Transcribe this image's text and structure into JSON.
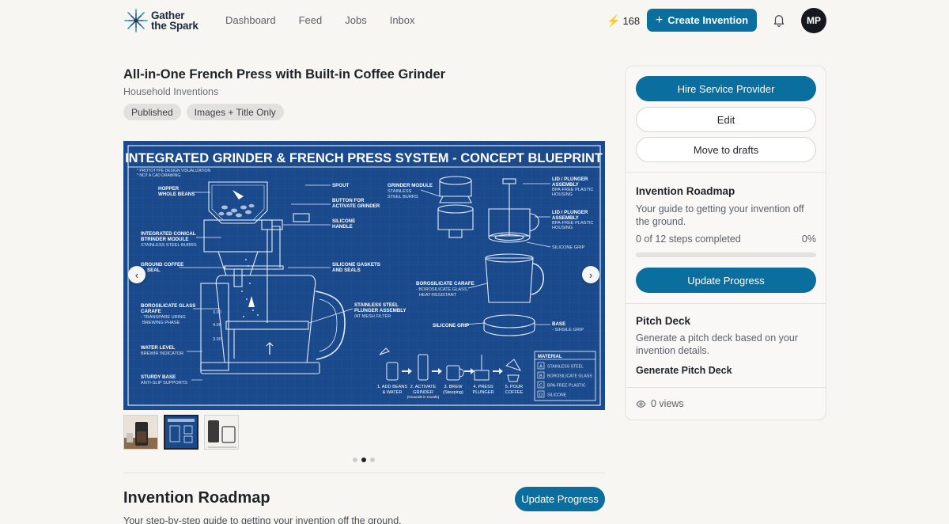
{
  "header": {
    "logo_line1": "Gather",
    "logo_line2": "the Spark",
    "nav": [
      "Dashboard",
      "Feed",
      "Jobs",
      "Inbox"
    ],
    "credits": "168",
    "create_label": "Create Invention",
    "avatar_initials": "MP"
  },
  "invention": {
    "title": "All-in-One French Press with Built-in Coffee Grinder",
    "category": "Household Inventions",
    "tags": [
      "Published",
      "Images + Title Only"
    ]
  },
  "blueprint": {
    "heading": "INTEGRATED GRINDER & FRENCH PRESS SYSTEM - CONCEPT BLUEPRINT",
    "note1": "* PROTOTYPE DESIGN VISUALIZATION",
    "note2": "* NOT A CAD DRAWING",
    "labels": {
      "hopper": "HOPPER",
      "hopper2": "WHOLE BEANS",
      "spout": "SPOUT",
      "button": "BUTTON FOR",
      "button2": "ACTIVATE GRINDER",
      "handle": "SILICONE",
      "handle2": "HANDLE",
      "grinder": "INTEGRATED CONICAL",
      "grinder2": "BTRINDER MODULE",
      "grinder3": "STAINLESS STEEL BURRS",
      "ground": "GROUND COFFEE",
      "ground2": "SEAL",
      "gaskets": "SILICONE GASKETS",
      "gaskets2": "AND SEALS",
      "carafe": "BOROSILICATE GLASS",
      "carafe2": "CARAFE",
      "carafe3": "- TRANSPARE URING",
      "carafe4": "BREWING PHASE",
      "plunger": "STAINLESS STEEL",
      "plunger2": "PLUNGER ASSEMBLY",
      "plunger3": "/AT MESH FILTER",
      "water": "WATER LEVEL",
      "water2": "BREWIR INDICATOR",
      "base": "STURDY BASE",
      "base2": "ANTI-SLIP SUPPORTS",
      "m1": "3.00",
      "m2": "4.00",
      "m3": "3.00",
      "gm": "GRINDER MODULE",
      "gm2": "STAINLESS",
      "gm3": "STEEL BURRS",
      "lid": "LID / PLUNGER",
      "lid2": "ASSEMBLY",
      "lid3": "BPA-FREE PLASTIC",
      "lid4": "HOUSING",
      "lidb": "LID / PLUNGER",
      "lidb2": "ASSEMBLY",
      "lidb3": "BPA-FREE PLASTIC",
      "lidb4": "HOUSING",
      "sgrip": "SILICONE GRIP",
      "bcar": "BOROSILICATE CARAFE",
      "bcar2": "- BOROSILICATE GLASS,",
      "bcar3": "HEAT-RESISTANT",
      "sgrip2": "SILICONE GRIP",
      "bse": "BASE",
      "bse2": "- SIHSILE GRIP"
    },
    "steps": [
      {
        "l1": "1. ADD BEANS",
        "l2": "& WATER",
        "l3": ""
      },
      {
        "l1": "2. ACTIVATE",
        "l2": "GRINDER",
        "l3": "(Grounds in Carafe)"
      },
      {
        "l1": "3. BREW",
        "l2": "(Steeping)",
        "l3": ""
      },
      {
        "l1": "4. PRESS",
        "l2": "PLUNGER",
        "l3": ""
      },
      {
        "l1": "5. POUR",
        "l2": "COFFEE",
        "l3": ""
      }
    ],
    "material_title": "MATERIAL",
    "materials": [
      {
        "k": "A",
        "v": "STAINLESS STEEL"
      },
      {
        "k": "B",
        "v": "BOROSILICATE GLASS"
      },
      {
        "k": "C",
        "v": "BPA-FREE PLASTIC"
      },
      {
        "k": "D",
        "v": "SILICONE"
      }
    ]
  },
  "gallery": {
    "prev_icon": "chevron-left-icon",
    "next_icon": "chevron-right-icon",
    "active_thumb": 1,
    "active_dot": 1
  },
  "roadmap_section": {
    "heading": "Invention Roadmap",
    "button": "Update Progress",
    "subtitle": "Your step-by-step guide to getting your invention off the ground."
  },
  "sidebar": {
    "hire": "Hire Service Provider",
    "edit": "Edit",
    "drafts": "Move to drafts",
    "roadmap_title": "Invention Roadmap",
    "roadmap_desc": "Your guide to getting your invention off the ground.",
    "steps_completed": "0 of 12 steps completed",
    "percent": "0%",
    "progress_fraction": 0,
    "update_btn": "Update Progress",
    "pitch_title": "Pitch Deck",
    "pitch_desc": "Generate a pitch deck based on your invention details.",
    "pitch_link": "Generate Pitch Deck",
    "views": "0 views"
  },
  "colors": {
    "accent": "#0a6e9e",
    "blueprint": "#1a4a8c",
    "bolt": "#f4b400"
  }
}
